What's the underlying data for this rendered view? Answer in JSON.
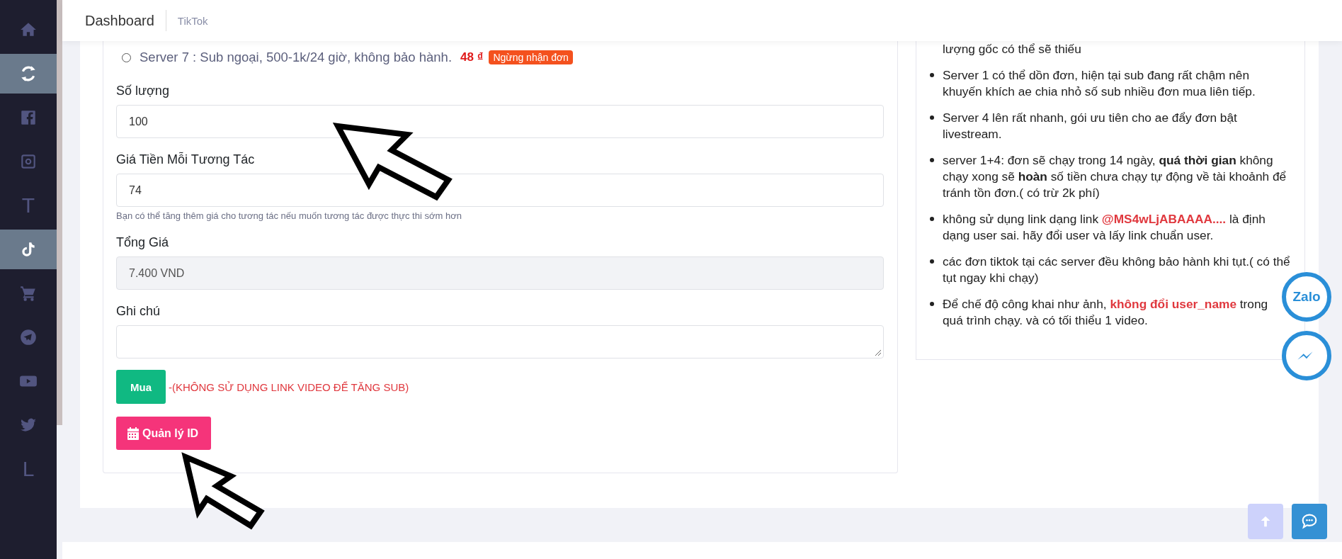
{
  "sidebar": {
    "items": [
      {
        "kind": "icon",
        "selected": false
      },
      {
        "kind": "icon",
        "selected": true
      },
      {
        "kind": "icon",
        "selected": false
      },
      {
        "kind": "icon",
        "selected": false
      },
      {
        "kind": "letter",
        "label": "T",
        "selected": false
      },
      {
        "kind": "icon",
        "selected": true
      },
      {
        "kind": "icon",
        "selected": false
      },
      {
        "kind": "icon",
        "selected": false
      },
      {
        "kind": "icon",
        "selected": false
      },
      {
        "kind": "icon",
        "selected": false
      },
      {
        "kind": "letter",
        "label": "L",
        "selected": false
      }
    ]
  },
  "header": {
    "title": "Dashboard",
    "crumb": "TikTok"
  },
  "form": {
    "server_option": {
      "label": "Server 7 : Sub ngoại, 500-1k/24 giờ, không bảo hành.",
      "selected": false,
      "price": "48 ₫",
      "badge": "Ngừng nhận đơn"
    },
    "fields": [
      {
        "kind": "input",
        "label": "Số lượng",
        "value": "100",
        "disabled": false
      },
      {
        "kind": "input",
        "label": "Giá Tiền Mỗi Tương Tác",
        "value": "74",
        "disabled": false,
        "help": "Bạn có thể tăng thêm giá cho tương tác nếu muốn tương tác được thực thi sớm hơn"
      },
      {
        "kind": "input",
        "label": "Tổng Giá",
        "value": "7.400 VND",
        "disabled": true
      },
      {
        "kind": "textarea",
        "label": "Ghi chú",
        "disabled": false
      }
    ],
    "buy_button": "Mua",
    "buy_note": "-(KHÔNG SỬ DỤNG LINK VIDEO ĐỂ TĂNG SUB)",
    "manage_button": "Quản lý ID"
  },
  "notes": {
    "items": [
      {
        "bullet": false,
        "segments": [
          {
            "kind": "plain",
            "text": "lượng gốc có thể sẽ thiếu"
          }
        ]
      },
      {
        "bullet": true,
        "segments": [
          {
            "kind": "plain",
            "text": "Server 1 có thể dồn đơn, hiện tại sub đang rất chậm nên khuyến khích ae chia nhỏ số sub nhiều đơn mua liên tiếp."
          }
        ]
      },
      {
        "bullet": true,
        "segments": [
          {
            "kind": "plain",
            "text": "Server 4 lên rất nhanh, gói ưu tiên cho ae đẩy đơn bật livestream."
          }
        ]
      },
      {
        "bullet": true,
        "segments": [
          {
            "kind": "plain",
            "text": "server 1+4: đơn sẽ chạy trong 14 ngày, "
          },
          {
            "kind": "strong",
            "text": "quá thời gian"
          },
          {
            "kind": "plain",
            "text": " không chạy xong sẽ "
          },
          {
            "kind": "strong",
            "text": "hoàn"
          },
          {
            "kind": "plain",
            "text": " số tiền chưa chạy tự động về tài khoảnh để tránh tồn đơn.( có trừ 2k phí)"
          }
        ]
      },
      {
        "bullet": true,
        "segments": [
          {
            "kind": "plain",
            "text": "không sử dụng link dạng link "
          },
          {
            "kind": "alert",
            "text": "@MS4wLjABAAAA...."
          },
          {
            "kind": "plain",
            "text": " là định dạng user sai. hãy đổi user và lấy link chuẩn user."
          }
        ]
      },
      {
        "bullet": true,
        "segments": [
          {
            "kind": "plain",
            "text": "các đơn tiktok tại các server đều không bảo hành khi tụt.( có thể tụt ngay khi chạy)"
          }
        ]
      },
      {
        "bullet": true,
        "segments": [
          {
            "kind": "plain",
            "text": "Để chế độ công khai như ảnh, "
          },
          {
            "kind": "alert",
            "text": "không đổi user_name"
          },
          {
            "kind": "plain",
            "text": " trong quá trình chạy. và có tối thiểu 1 video."
          }
        ]
      }
    ]
  },
  "floating": {
    "zalo": "Zalo"
  }
}
